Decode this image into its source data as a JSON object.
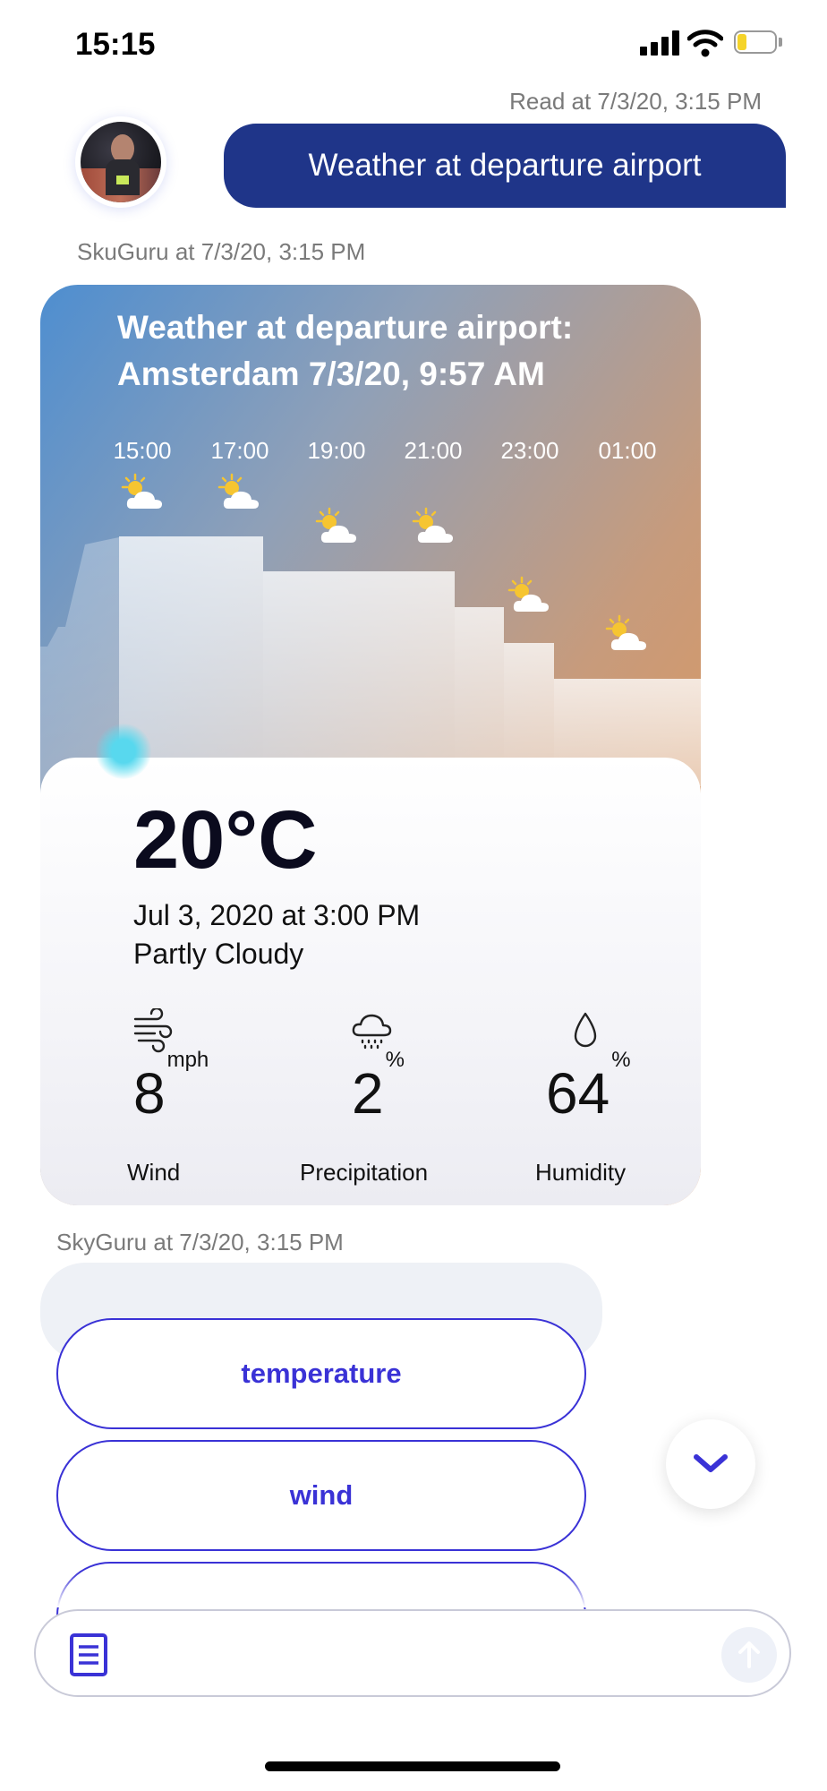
{
  "status_bar": {
    "time": "15:15",
    "battery_color": "#f5d42a"
  },
  "chat": {
    "read_receipt": "Read at 7/3/20, 3:15 PM",
    "user_message": "Weather at departure airport",
    "user_bubble_color": "#1f3589"
  },
  "weather_message": {
    "sender": "SkuGuru at 7/3/20, 3:15 PM",
    "title_line1": "Weather at departure airport:",
    "title_line2": "Amsterdam 7/3/20, 9:57 AM",
    "hours": [
      "15:00",
      "17:00",
      "19:00",
      "21:00",
      "23:00",
      "01:00"
    ],
    "hour_icons": [
      "partly-cloudy-icon",
      "partly-cloudy-icon",
      "partly-cloudy-icon",
      "partly-cloudy-icon",
      "partly-cloudy-icon",
      "partly-cloudy-icon"
    ],
    "temperature": "20°C",
    "date_line": "Jul 3, 2020 at 3:00 PM",
    "condition": "Partly Cloudy",
    "wind": {
      "value": "8",
      "unit": "mph",
      "label": "Wind",
      "icon": "wind-icon"
    },
    "precipitation": {
      "value": "2",
      "unit": "%",
      "label": "Precipitation",
      "icon": "rain-cloud-icon"
    },
    "humidity": {
      "value": "64",
      "unit": "%",
      "label": "Humidity",
      "icon": "droplet-icon"
    }
  },
  "suggestions": {
    "sender": "SkyGuru at 7/3/20, 3:15 PM",
    "chips": [
      "temperature",
      "wind"
    ],
    "accent_color": "#3a32d6"
  },
  "input": {
    "menu_icon": "document-icon",
    "send_icon": "arrow-up-icon"
  }
}
